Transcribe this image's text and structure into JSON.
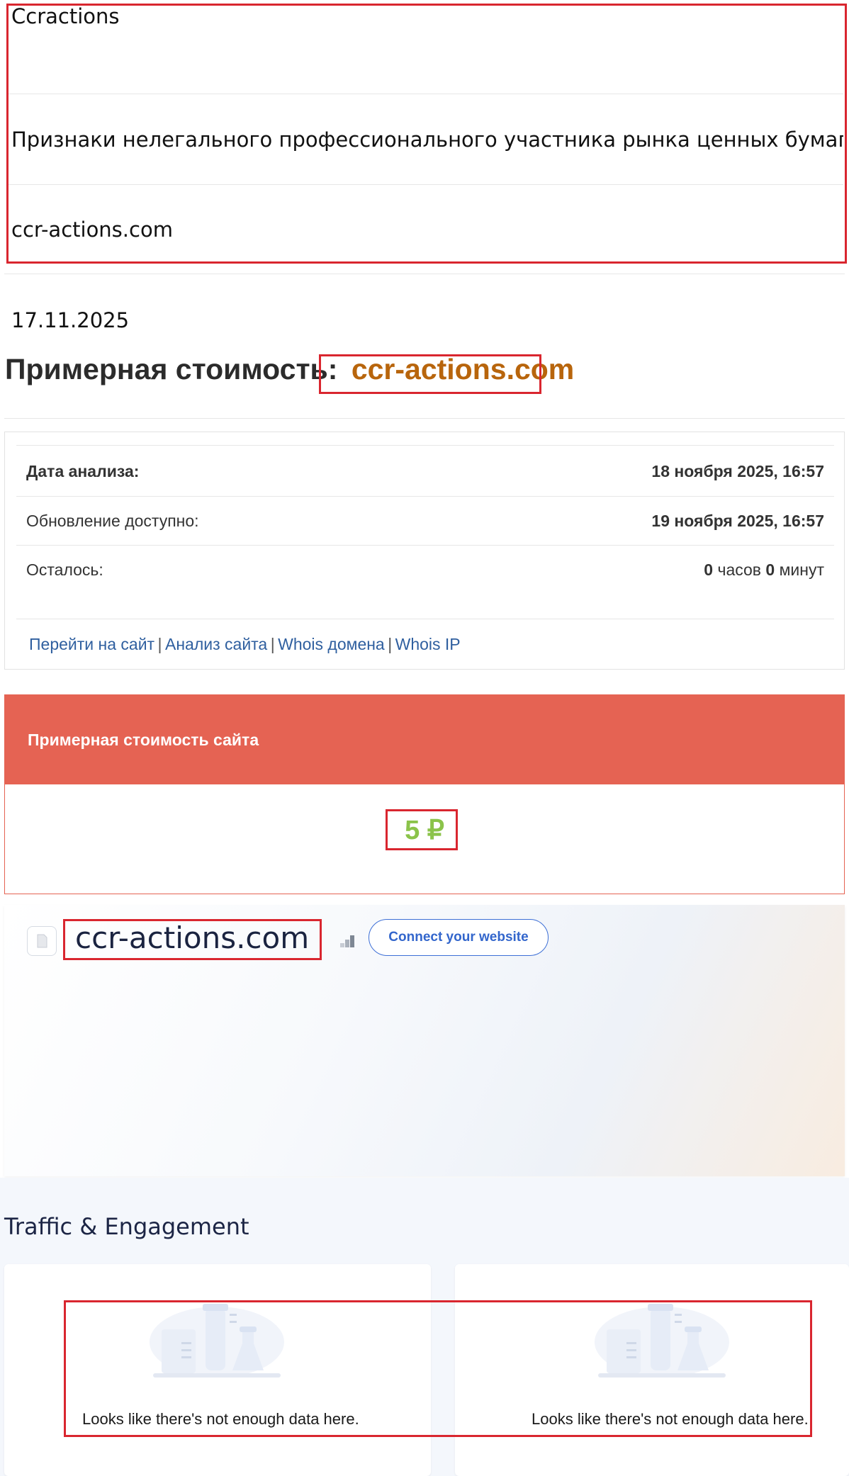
{
  "top": {
    "name": "Ccractions",
    "subject": "Признаки нелегального профессионального участника рынка ценных бумаг",
    "domain": "ccr-actions.com"
  },
  "date": "17.11.2025",
  "estimate": {
    "title_prefix": "Примерная стоимость:",
    "title_domain": "ccr-actions.com"
  },
  "analysis": {
    "rows": [
      {
        "label": "Дата анализа:",
        "value": "18 ноября 2025, 16:57"
      },
      {
        "label": "Обновление доступно:",
        "value": "19 ноября 2025, 16:57"
      },
      {
        "label": "Осталось:",
        "value_hours_num": "0",
        "value_hours_unit": "часов",
        "value_min_num": "0",
        "value_min_unit": "минут"
      }
    ],
    "links": [
      "Перейти на сайт",
      "Анализ сайта",
      "Whois домена",
      "Whois IP"
    ],
    "separator": "|"
  },
  "site_value": {
    "header": "Примерная стоимость сайта",
    "value": "5 ₽"
  },
  "similarweb": {
    "domain": "ccr-actions.com",
    "connect_label": "Connect your website",
    "section_title": "Traffic & Engagement",
    "nodata_left": "Looks like there's not enough data here.",
    "nodata_right": "Looks like there's not enough data here."
  },
  "colors": {
    "red_header": "#e56353",
    "green_value": "#8bc34a",
    "domain_orange": "#b8650c",
    "annotation_red": "#d9262f",
    "link_blue": "#2f5f9f",
    "connect_blue": "#3366cc"
  }
}
